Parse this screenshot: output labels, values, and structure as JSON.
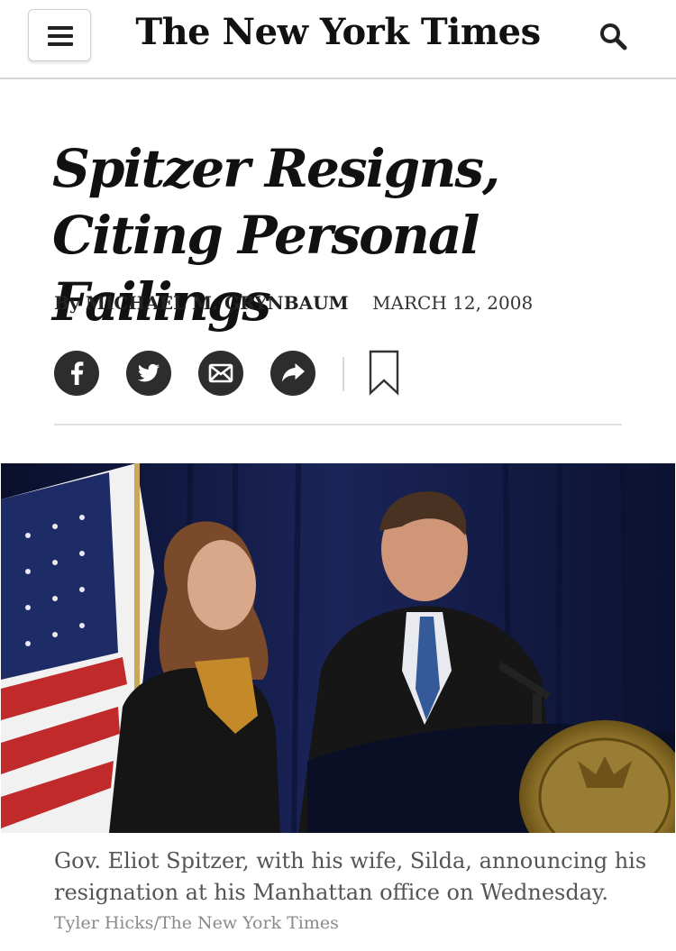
{
  "header": {
    "logo_text": "The New York Times",
    "menu_icon": "hamburger-menu-icon",
    "search_icon": "search-icon"
  },
  "article": {
    "headline": "Spitzer Resigns, Citing Personal Failings",
    "byline_prefix": "By",
    "author": "MICHAEL M. GRYNBAUM",
    "date": "MARCH 12, 2008"
  },
  "share": {
    "icons": [
      "facebook-icon",
      "twitter-icon",
      "email-icon",
      "share-arrow-icon",
      "bookmark-icon"
    ]
  },
  "photo": {
    "caption": "Gov. Eliot Spitzer, with his wife, Silda, announcing his resignation at his Manhattan office on Wednesday.",
    "credit": "Tyler Hicks/The New York Times"
  },
  "colors": {
    "icon_bg": "#2d2d2d",
    "text": "#121212",
    "caption": "#555555",
    "credit": "#8a8a8a",
    "curtain": "#0d1431"
  }
}
